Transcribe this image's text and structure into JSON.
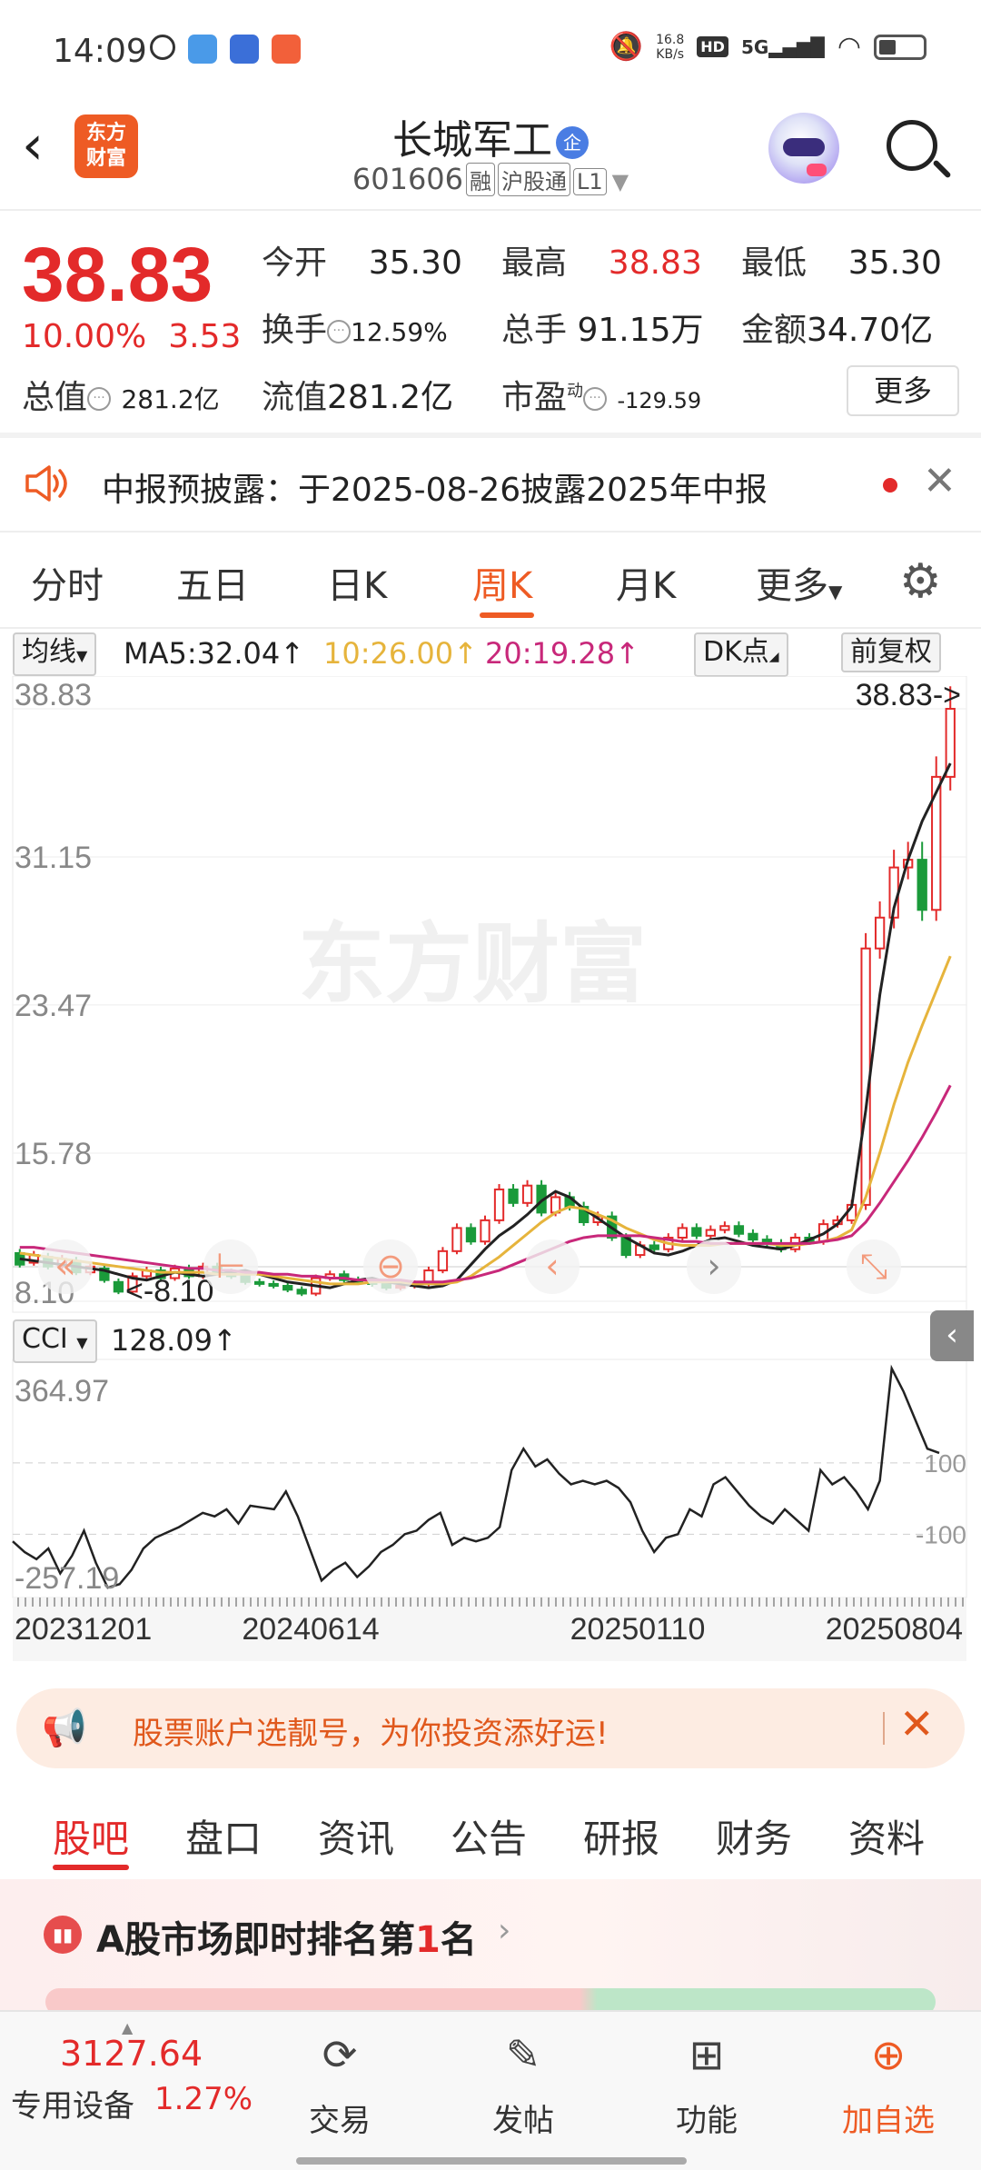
{
  "status_bar": {
    "time": "14:09",
    "net_speed_value": "16.8",
    "net_speed_unit": "KB/s",
    "hd": "HD",
    "network": "5G"
  },
  "header": {
    "logo_line1": "东方",
    "logo_line2": "财富",
    "stock_name": "长城军工",
    "badge": "企",
    "code": "601606",
    "tags": [
      "融",
      "沪股通",
      "L1"
    ]
  },
  "quote": {
    "price": "38.83",
    "change_pct": "10.00%",
    "change_abs": "3.53",
    "cells": {
      "open_label": "今开",
      "open": "35.30",
      "high_label": "最高",
      "high": "38.83",
      "low_label": "最低",
      "low": "35.30",
      "turnover_label": "换手",
      "turnover": "12.59%",
      "volume_label": "总手",
      "volume": "91.15万",
      "amount_label": "金额",
      "amount": "34.70亿",
      "mcap_label": "总值",
      "mcap": "281.2亿",
      "float_label": "流值",
      "float": "281.2亿",
      "pe_label": "市盈",
      "pe_sup": "动",
      "pe": "-129.59"
    },
    "more": "更多"
  },
  "notice": {
    "text": "中报预披露：于2025-08-26披露2025年中报"
  },
  "chart_tabs": {
    "items": [
      "分时",
      "五日",
      "日K",
      "周K",
      "月K",
      "更多"
    ],
    "active": "周K"
  },
  "indicator": {
    "selector": "均线",
    "ma5": "MA5:32.04↑",
    "ma10": "10:26.00↑",
    "ma20": "20:19.28↑",
    "dk": "DK点",
    "adjust": "前复权",
    "colors": {
      "ma5": "#222222",
      "ma10": "#e6b43c",
      "ma20": "#c8287a"
    }
  },
  "chart_data": [
    {
      "type": "candlestick",
      "y_ticks": [
        "38.83",
        "31.15",
        "23.47",
        "15.78",
        "8.10"
      ],
      "ylim": [
        8.1,
        38.83
      ],
      "max_label": "38.83->",
      "min_label": "<-8.10",
      "watermark": "东方财富",
      "x_ticks": [
        "20231201",
        "20240614",
        "20250110",
        "20250804"
      ],
      "series": [
        {
          "name": "MA5",
          "values": [
            10.3,
            10.2,
            10.1,
            10.0,
            9.9,
            9.8,
            9.7,
            9.5,
            9.3,
            9.2,
            9.4,
            9.6,
            9.5,
            9.4,
            9.5,
            9.6,
            9.7,
            9.5,
            9.3,
            9.1,
            9.0,
            8.9,
            8.8,
            9.0,
            9.2,
            9.3,
            9.1,
            9.0,
            8.9,
            8.8,
            8.9,
            9.2,
            10.0,
            10.8,
            11.5,
            12.0,
            12.6,
            13.3,
            13.8,
            13.5,
            12.9,
            12.4,
            11.9,
            11.4,
            11.0,
            10.6,
            10.5,
            10.7,
            11.0,
            11.3,
            11.4,
            11.2,
            11.0,
            10.9,
            10.8,
            11.0,
            11.3,
            11.6,
            12.1,
            13.0,
            18.0,
            24.0,
            28.5,
            31.0,
            33.0,
            34.5,
            36.0
          ]
        },
        {
          "name": "MA10",
          "values": [
            10.6,
            10.5,
            10.4,
            10.3,
            10.2,
            10.1,
            10.0,
            9.9,
            9.8,
            9.7,
            9.6,
            9.6,
            9.6,
            9.6,
            9.5,
            9.5,
            9.5,
            9.5,
            9.4,
            9.3,
            9.2,
            9.1,
            9.0,
            9.0,
            9.0,
            9.1,
            9.1,
            9.1,
            9.0,
            9.0,
            9.0,
            9.1,
            9.4,
            9.9,
            10.4,
            11.0,
            11.6,
            12.2,
            12.7,
            13.0,
            12.9,
            12.6,
            12.3,
            11.9,
            11.6,
            11.3,
            11.1,
            11.0,
            11.0,
            11.0,
            11.1,
            11.1,
            11.1,
            11.1,
            11.0,
            11.0,
            11.1,
            11.2,
            11.4,
            11.8,
            13.5,
            15.8,
            18.3,
            20.5,
            22.4,
            24.2,
            26.0
          ]
        },
        {
          "name": "MA20",
          "values": [
            10.9,
            10.9,
            10.8,
            10.7,
            10.6,
            10.5,
            10.4,
            10.3,
            10.2,
            10.1,
            10.0,
            9.9,
            9.8,
            9.8,
            9.7,
            9.7,
            9.6,
            9.6,
            9.5,
            9.5,
            9.4,
            9.4,
            9.3,
            9.3,
            9.2,
            9.2,
            9.2,
            9.2,
            9.1,
            9.1,
            9.1,
            9.2,
            9.3,
            9.5,
            9.7,
            10.0,
            10.3,
            10.6,
            10.9,
            11.2,
            11.4,
            11.5,
            11.5,
            11.5,
            11.5,
            11.4,
            11.3,
            11.2,
            11.2,
            11.1,
            11.1,
            11.1,
            11.1,
            11.1,
            11.1,
            11.1,
            11.1,
            11.2,
            11.3,
            11.5,
            12.2,
            13.2,
            14.3,
            15.4,
            16.6,
            17.9,
            19.3
          ]
        }
      ],
      "candles": [
        [
          10.6,
          10.0
        ],
        [
          10.1,
          10.5
        ],
        [
          10.4,
          9.9
        ],
        [
          9.9,
          10.3
        ],
        [
          10.2,
          9.6
        ],
        [
          9.6,
          9.9
        ],
        [
          9.8,
          9.2
        ],
        [
          9.1,
          8.6
        ],
        [
          8.6,
          9.4
        ],
        [
          9.4,
          9.7
        ],
        [
          9.7,
          9.3
        ],
        [
          9.3,
          9.8
        ],
        [
          9.8,
          9.4
        ],
        [
          9.4,
          9.9
        ],
        [
          9.9,
          9.6
        ],
        [
          9.6,
          9.4
        ],
        [
          9.4,
          9.1
        ],
        [
          9.1,
          9.0
        ],
        [
          9.0,
          8.9
        ],
        [
          8.9,
          8.7
        ],
        [
          8.7,
          8.5
        ],
        [
          8.5,
          9.3
        ],
        [
          9.3,
          9.5
        ],
        [
          9.5,
          9.2
        ],
        [
          9.2,
          9.1
        ],
        [
          9.1,
          9.0
        ],
        [
          9.0,
          8.8
        ],
        [
          8.8,
          8.9
        ],
        [
          8.9,
          9.0
        ],
        [
          9.0,
          9.7
        ],
        [
          9.7,
          10.7
        ],
        [
          10.7,
          11.9
        ],
        [
          11.9,
          11.2
        ],
        [
          11.2,
          12.3
        ],
        [
          12.3,
          13.9
        ],
        [
          13.9,
          13.2
        ],
        [
          13.2,
          14.1
        ],
        [
          14.1,
          12.7
        ],
        [
          12.7,
          13.5
        ],
        [
          13.5,
          13.0
        ],
        [
          13.0,
          12.2
        ],
        [
          12.2,
          12.5
        ],
        [
          12.5,
          11.4
        ],
        [
          11.4,
          10.5
        ],
        [
          10.5,
          11.0
        ],
        [
          11.0,
          10.8
        ],
        [
          10.8,
          11.4
        ],
        [
          11.4,
          11.9
        ],
        [
          11.9,
          11.5
        ],
        [
          11.5,
          11.8
        ],
        [
          11.8,
          12.0
        ],
        [
          12.0,
          11.6
        ],
        [
          11.6,
          11.3
        ],
        [
          11.3,
          11.1
        ],
        [
          11.1,
          10.8
        ],
        [
          10.8,
          11.4
        ],
        [
          11.4,
          11.2
        ],
        [
          11.2,
          12.1
        ],
        [
          12.1,
          12.3
        ],
        [
          12.3,
          13.1
        ],
        [
          13.1,
          26.4
        ],
        [
          26.4,
          28.0
        ],
        [
          28.0,
          30.6
        ],
        [
          30.6,
          31.0
        ],
        [
          31.0,
          28.4
        ],
        [
          28.4,
          35.3
        ],
        [
          35.3,
          38.83
        ]
      ]
    },
    {
      "type": "line",
      "name": "CCI",
      "current": "128.09↑",
      "y_ticks": [
        "364.97",
        "-257.19"
      ],
      "ref_lines": [
        "100",
        "-100"
      ],
      "ylim": [
        -257.19,
        364.97
      ],
      "values": [
        -120,
        -150,
        -170,
        -140,
        -210,
        -160,
        -90,
        -180,
        -250,
        -240,
        -200,
        -140,
        -110,
        -95,
        -80,
        -60,
        -40,
        -50,
        -30,
        -70,
        -20,
        -25,
        -30,
        20,
        -50,
        -140,
        -230,
        -200,
        -180,
        -220,
        -190,
        -150,
        -130,
        -100,
        -90,
        -60,
        -40,
        -130,
        -110,
        -120,
        -110,
        -80,
        80,
        140,
        90,
        110,
        70,
        40,
        50,
        40,
        50,
        30,
        -10,
        -90,
        -150,
        -110,
        -100,
        -30,
        -50,
        40,
        60,
        20,
        -20,
        -50,
        -70,
        -30,
        -60,
        -90,
        80,
        40,
        60,
        20,
        -30,
        50,
        365,
        300,
        220,
        140,
        128
      ]
    }
  ],
  "cci_selector": "CCI",
  "ad": {
    "text": "股票账户选靓号，为你投资添好运!"
  },
  "section_tabs": {
    "items": [
      "股吧",
      "盘口",
      "资讯",
      "公告",
      "研报",
      "财务",
      "资料"
    ],
    "active": "股吧"
  },
  "rank": {
    "prefix": "A股市场即时排名第",
    "num": "1",
    "suffix": "名"
  },
  "bottom_nav": {
    "index_value": "3127.64",
    "index_name": "专用设备",
    "index_pct": "1.27%",
    "items": [
      "交易",
      "发帖",
      "功能",
      "加自选"
    ]
  }
}
